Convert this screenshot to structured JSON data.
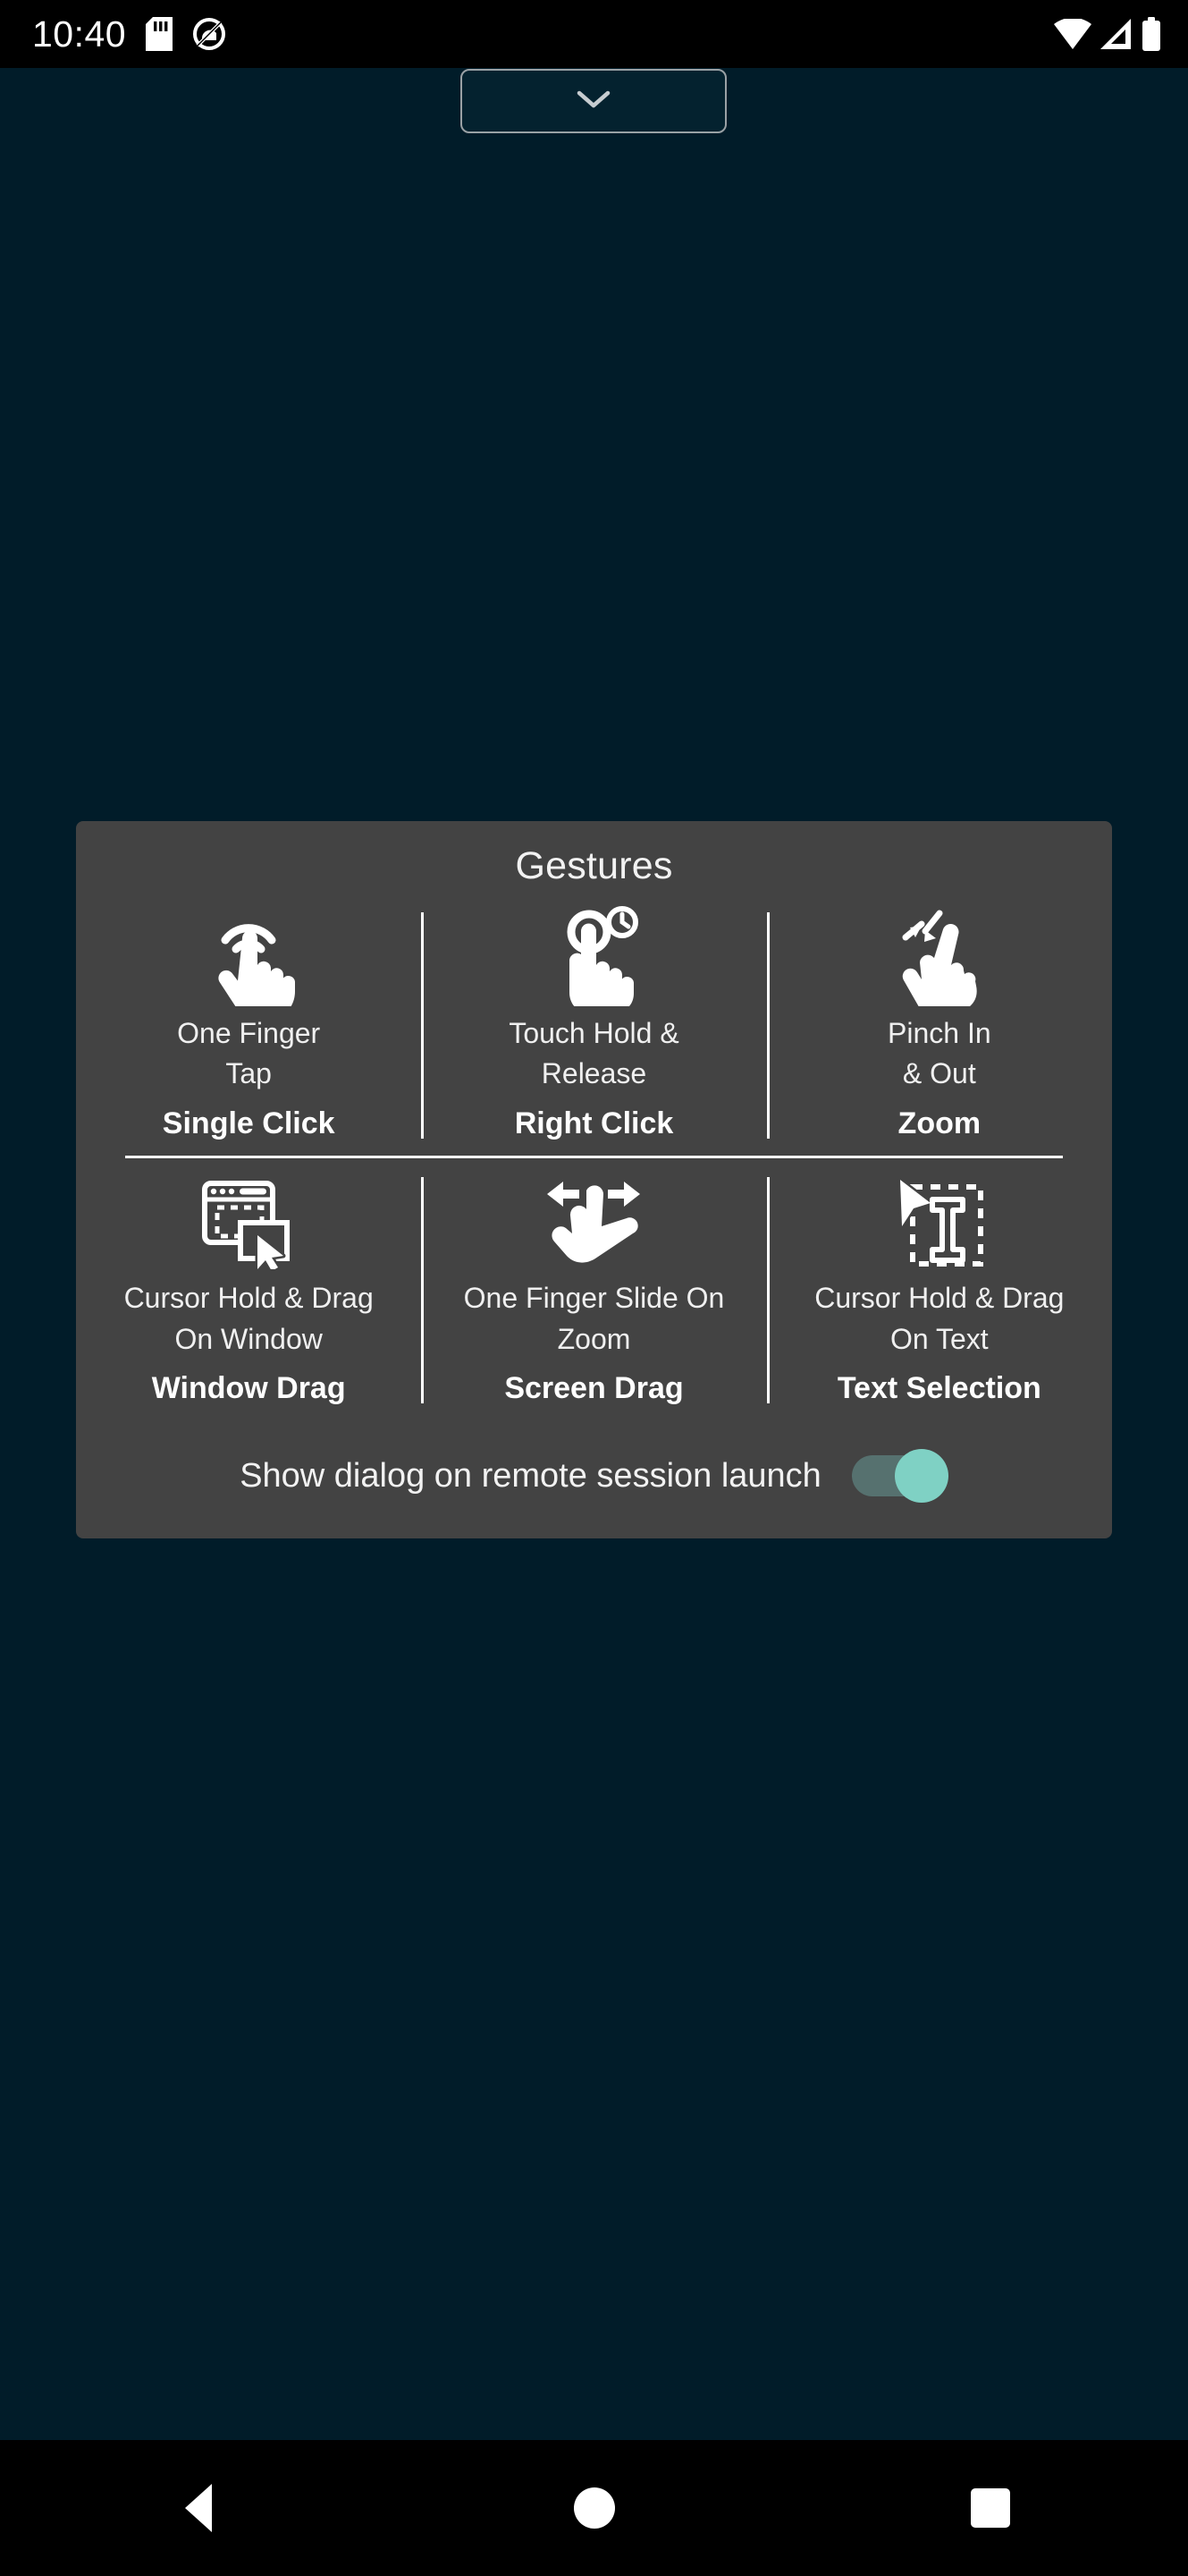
{
  "status_bar": {
    "clock": "10:40",
    "left_icons": [
      {
        "name": "sd-card-icon"
      },
      {
        "name": "do-not-disturb-icon"
      }
    ],
    "right_icons": [
      {
        "name": "wifi-icon"
      },
      {
        "name": "cellular-signal-icon"
      },
      {
        "name": "battery-icon"
      }
    ]
  },
  "top_bar": {
    "collapse_icon": "chevron-down-icon"
  },
  "dialog": {
    "title": "Gestures",
    "background_color": "#434343",
    "gestures": [
      {
        "icon": "one-finger-tap-icon",
        "description": "One Finger\nTap",
        "action": "Single Click"
      },
      {
        "icon": "touch-hold-release-icon",
        "description": "Touch Hold &\nRelease",
        "action": "Right Click"
      },
      {
        "icon": "pinch-zoom-icon",
        "description": "Pinch In\n& Out",
        "action": "Zoom"
      },
      {
        "icon": "window-drag-icon",
        "description": "Cursor Hold & Drag\nOn Window",
        "action": "Window Drag"
      },
      {
        "icon": "one-finger-slide-icon",
        "description": "One Finger Slide On\nZoom",
        "action": "Screen Drag"
      },
      {
        "icon": "text-selection-icon",
        "description": "Cursor Hold & Drag\nOn Text",
        "action": "Text Selection"
      }
    ],
    "toggle": {
      "label": "Show dialog on remote session launch",
      "state": "on",
      "thumb_color": "#7fd1c4",
      "track_color": "#56716f"
    }
  },
  "nav_bar": {
    "back": "back-icon",
    "home": "home-icon",
    "recents": "recents-icon"
  },
  "colors": {
    "screen_background": "#011c29",
    "system_bar": "#000000",
    "accent": "#7fd1c4"
  }
}
